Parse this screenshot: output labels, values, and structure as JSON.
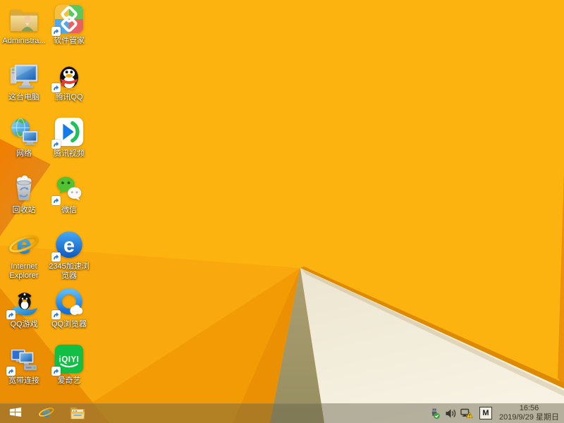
{
  "wallpaper": {
    "description": "Windows 8.1 default gold faceted abstract background",
    "palette": {
      "gold_base": "#FCB30F",
      "orange_wedge_light": "#F9A90D",
      "orange_wedge_mid": "#F39B05",
      "orange_wedge_deep": "#EB9003",
      "corner_orange": "#EC8E03",
      "kite_orange": "#F17E00",
      "olive_facet": "#AC9F72",
      "cream_facet": "#F3EDDD",
      "fold_edge": "#DE8A00"
    }
  },
  "desktop": {
    "icons": [
      {
        "label": "Administra...",
        "name": "administrator-folder",
        "shortcut_overlay": false
      },
      {
        "label": "这台电脑",
        "name": "this-pc",
        "shortcut_overlay": false
      },
      {
        "label": "网络",
        "name": "network",
        "shortcut_overlay": false
      },
      {
        "label": "回收站",
        "name": "recycle-bin",
        "shortcut_overlay": false
      },
      {
        "label": "Internet Explorer",
        "name": "internet-explorer",
        "shortcut_overlay": false
      },
      {
        "label": "QQ游戏",
        "name": "qq-games",
        "shortcut_overlay": true
      },
      {
        "label": "宽带连接",
        "name": "broadband-connection",
        "shortcut_overlay": true
      },
      {
        "label": "软件管家",
        "name": "software-manager",
        "shortcut_overlay": true
      },
      {
        "label": "腾讯QQ",
        "name": "tencent-qq",
        "shortcut_overlay": true
      },
      {
        "label": "腾讯视频",
        "name": "tencent-video",
        "shortcut_overlay": true
      },
      {
        "label": "微信",
        "name": "wechat",
        "shortcut_overlay": true
      },
      {
        "label": "2345加速浏览器",
        "name": "2345-browser",
        "shortcut_overlay": true
      },
      {
        "label": "QQ浏览器",
        "name": "qq-browser",
        "shortcut_overlay": true
      },
      {
        "label": "爱奇艺",
        "name": "iqiyi",
        "shortcut_overlay": true
      }
    ]
  },
  "taskbar": {
    "pinned": [
      {
        "name": "internet-explorer"
      },
      {
        "name": "file-explorer"
      }
    ],
    "tray": {
      "input_indicator": "M",
      "time": "16:56",
      "date": "2019/9/29 星期日"
    }
  }
}
